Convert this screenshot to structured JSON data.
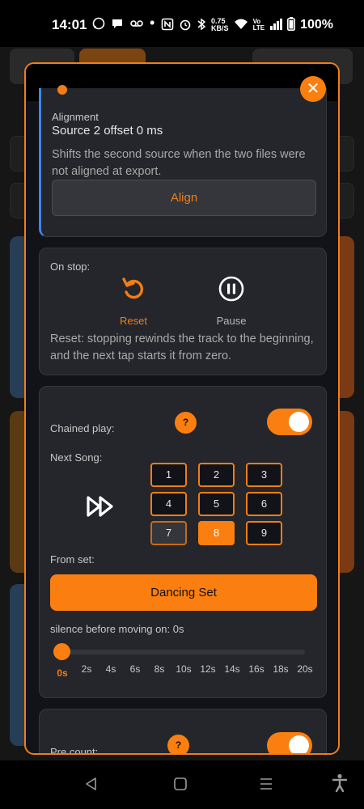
{
  "status": {
    "time": "14:01",
    "battery": "100%",
    "speed_top": "0.75",
    "speed_bottom": "KB/S"
  },
  "alignment": {
    "label": "Alignment",
    "value": "Source 2 offset 0 ms",
    "description": "Shifts the second source when the two files were not aligned at export.",
    "button": "Align"
  },
  "on_stop": {
    "label": "On stop:",
    "options": [
      {
        "label": "Reset",
        "selected": true
      },
      {
        "label": "Pause",
        "selected": false
      }
    ],
    "description": "Reset: stopping rewinds the track to the beginning, and the next tap starts it from zero."
  },
  "chained_play": {
    "label": "Chained play:",
    "help": "?",
    "enabled": true,
    "next_song_label": "Next Song:",
    "songs": [
      "1",
      "2",
      "3",
      "4",
      "5",
      "6",
      "7",
      "8",
      "9"
    ],
    "selected_song": "8",
    "from_set_label": "From set:",
    "set_name": "Dancing Set",
    "silence_label": "silence before moving on: 0s",
    "silence_ticks": [
      "0s",
      "2s",
      "4s",
      "6s",
      "8s",
      "10s",
      "12s",
      "14s",
      "16s",
      "18s",
      "20s"
    ],
    "silence_value": "0s"
  },
  "pre_count": {
    "label": "Pre count:",
    "help": "?",
    "enabled": true
  },
  "colors": {
    "accent": "#fb7f10",
    "panel": "#24262b",
    "alignment_bar": "#3f87e8"
  }
}
